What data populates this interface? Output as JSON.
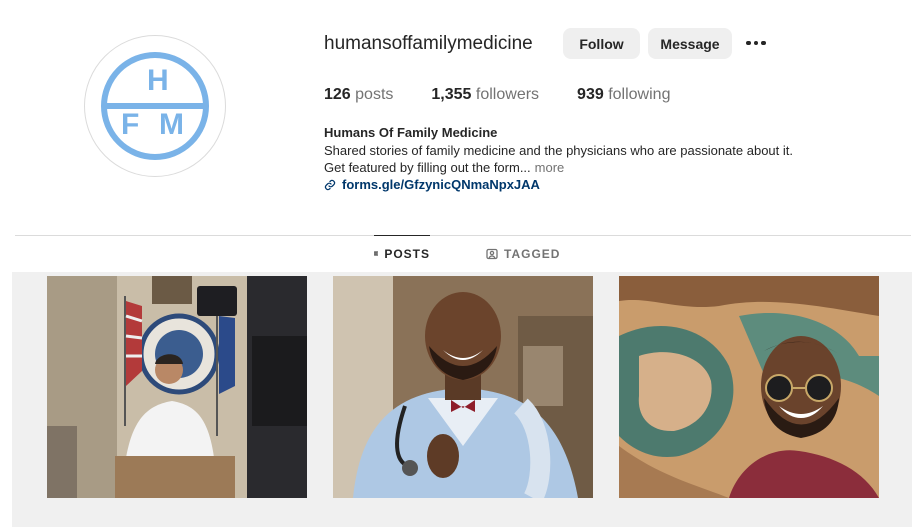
{
  "profile": {
    "avatar_letters": [
      "H",
      "F",
      "M"
    ],
    "username": "humansoffamilymedicine",
    "follow_label": "Follow",
    "message_label": "Message",
    "more_icon": "ellipsis-icon",
    "stats": {
      "posts_count": "126",
      "posts_label": "posts",
      "followers_count": "1,355",
      "followers_label": "followers",
      "following_count": "939",
      "following_label": "following"
    },
    "full_name": "Humans Of Family Medicine",
    "bio_line1": "Shared stories of family medicine and the physicians who are passionate about it.",
    "bio_line2": "Get featured by filling out the form...",
    "more_label": "more",
    "link_text": "forms.gle/GfzynicQNmaNpxJAA",
    "link_icon": "link-icon"
  },
  "tabs": [
    {
      "label": "POSTS",
      "icon": "grid-icon",
      "active": true
    },
    {
      "label": "TAGGED",
      "icon": "tagged-icon",
      "active": false
    }
  ],
  "posts": [
    {
      "subject": "doctor at podium press conference photo"
    },
    {
      "subject": "smiling doctor with stethoscope photo"
    },
    {
      "subject": "selfie at canyon photo"
    }
  ],
  "colors": {
    "brand_blue": "#7ab3e8",
    "button_bg": "#efefef",
    "link": "#00376b",
    "muted": "#737373"
  }
}
